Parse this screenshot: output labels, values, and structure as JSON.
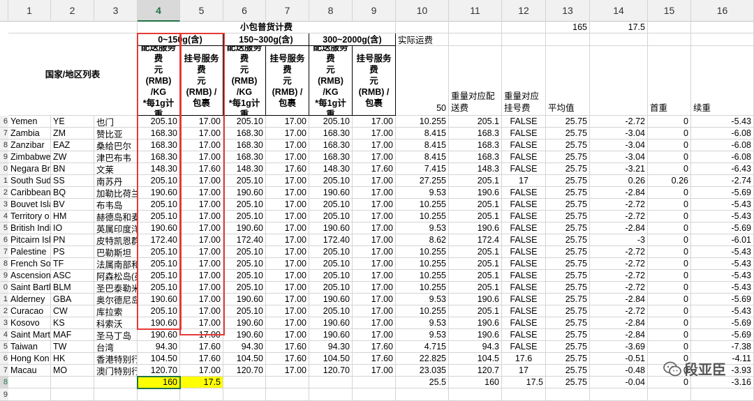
{
  "col_headers": [
    "1",
    "2",
    "3",
    "4",
    "5",
    "6",
    "7",
    "8",
    "9",
    "10",
    "11",
    "12",
    "13",
    "14",
    "15",
    "16"
  ],
  "selected_col": "4",
  "top_values": {
    "m": "165",
    "n": "17.5"
  },
  "merged_header": "小包普货计费",
  "range_headers": [
    "0~150g(含)",
    "150~300g(含)",
    "300~2000g(含)"
  ],
  "actual_freight_label": "实际运费",
  "country_list_label": "国家/地区列表",
  "delivery_header": "配送服务费\n元\n(RMB)\n/KG\n*每1g计重",
  "register_header": "挂号服务费\n元\n(RMB) /\n包裹",
  "subheader_j": "50",
  "subheader_k": "重量对应配送费",
  "subheader_l": "重量对应挂号费",
  "subheader_m": "平均值",
  "subheader_o": "首重",
  "subheader_p": "续重",
  "rows": [
    {
      "n": "6",
      "en": "Yemen",
      "code": "YE",
      "cn": "也门",
      "d1": "205.10",
      "r1": "17.00",
      "d2": "205.10",
      "r2": "17.00",
      "d3": "205.10",
      "r3": "17.00",
      "j": "10.255",
      "k": "205.1",
      "l": "FALSE",
      "m": "25.75",
      "n2": "-2.72",
      "o": "0",
      "p": "-5.43"
    },
    {
      "n": "7",
      "en": "Zambia",
      "code": "ZM",
      "cn": "赞比亚",
      "d1": "168.30",
      "r1": "17.00",
      "d2": "168.30",
      "r2": "17.00",
      "d3": "168.30",
      "r3": "17.00",
      "j": "8.415",
      "k": "168.3",
      "l": "FALSE",
      "m": "25.75",
      "n2": "-3.04",
      "o": "0",
      "p": "-6.08"
    },
    {
      "n": "8",
      "en": "Zanzibar",
      "code": "EAZ",
      "cn": "桑给巴尔",
      "d1": "168.30",
      "r1": "17.00",
      "d2": "168.30",
      "r2": "17.00",
      "d3": "168.30",
      "r3": "17.00",
      "j": "8.415",
      "k": "168.3",
      "l": "FALSE",
      "m": "25.75",
      "n2": "-3.04",
      "o": "0",
      "p": "-6.08"
    },
    {
      "n": "9",
      "en": "Zimbabwe",
      "code": "ZW",
      "cn": "津巴布韦",
      "d1": "168.30",
      "r1": "17.00",
      "d2": "168.30",
      "r2": "17.00",
      "d3": "168.30",
      "r3": "17.00",
      "j": "8.415",
      "k": "168.3",
      "l": "FALSE",
      "m": "25.75",
      "n2": "-3.04",
      "o": "0",
      "p": "-6.08"
    },
    {
      "n": "0",
      "en": "Negara Bru",
      "code": "BN",
      "cn": "文莱",
      "d1": "148.30",
      "r1": "17.60",
      "d2": "148.30",
      "r2": "17.60",
      "d3": "148.30",
      "r3": "17.60",
      "j": "7.415",
      "k": "148.3",
      "l": "FALSE",
      "m": "25.75",
      "n2": "-3.21",
      "o": "0",
      "p": "-6.43"
    },
    {
      "n": "1",
      "en": "South Sud",
      "code": "SS",
      "cn": "南苏丹",
      "d1": "205.10",
      "r1": "17.00",
      "d2": "205.10",
      "r2": "17.00",
      "d3": "205.10",
      "r3": "17.00",
      "j": "27.255",
      "k": "205.1",
      "l": "17",
      "m": "25.75",
      "n2": "0.26",
      "o": "0.26",
      "p": "-2.74"
    },
    {
      "n": "2",
      "en": "Caribbean",
      "code": "BQ",
      "cn": "加勒比荷兰",
      "d1": "190.60",
      "r1": "17.00",
      "d2": "190.60",
      "r2": "17.00",
      "d3": "190.60",
      "r3": "17.00",
      "j": "9.53",
      "k": "190.6",
      "l": "FALSE",
      "m": "25.75",
      "n2": "-2.84",
      "o": "0",
      "p": "-5.69"
    },
    {
      "n": "3",
      "en": "Bouvet Isla",
      "code": "BV",
      "cn": "布韦岛",
      "d1": "205.10",
      "r1": "17.00",
      "d2": "205.10",
      "r2": "17.00",
      "d3": "205.10",
      "r3": "17.00",
      "j": "10.255",
      "k": "205.1",
      "l": "FALSE",
      "m": "25.75",
      "n2": "-2.72",
      "o": "0",
      "p": "-5.43"
    },
    {
      "n": "4",
      "en": "Territory o",
      "code": "HM",
      "cn": "赫德岛和麦",
      "d1": "205.10",
      "r1": "17.00",
      "d2": "205.10",
      "r2": "17.00",
      "d3": "205.10",
      "r3": "17.00",
      "j": "10.255",
      "k": "205.1",
      "l": "FALSE",
      "m": "25.75",
      "n2": "-2.72",
      "o": "0",
      "p": "-5.43"
    },
    {
      "n": "5",
      "en": "British Indi",
      "code": "IO",
      "cn": "英属印度洋",
      "d1": "190.60",
      "r1": "17.00",
      "d2": "190.60",
      "r2": "17.00",
      "d3": "190.60",
      "r3": "17.00",
      "j": "9.53",
      "k": "190.6",
      "l": "FALSE",
      "m": "25.75",
      "n2": "-2.84",
      "o": "0",
      "p": "-5.69"
    },
    {
      "n": "6",
      "en": "Pitcairn Isl",
      "code": "PN",
      "cn": "皮特凯恩群",
      "d1": "172.40",
      "r1": "17.00",
      "d2": "172.40",
      "r2": "17.00",
      "d3": "172.40",
      "r3": "17.00",
      "j": "8.62",
      "k": "172.4",
      "l": "FALSE",
      "m": "25.75",
      "n2": "-3",
      "o": "0",
      "p": "-6.01"
    },
    {
      "n": "7",
      "en": "Palestine",
      "code": "PS",
      "cn": "巴勒斯坦",
      "d1": "205.10",
      "r1": "17.00",
      "d2": "205.10",
      "r2": "17.00",
      "d3": "205.10",
      "r3": "17.00",
      "j": "10.255",
      "k": "205.1",
      "l": "FALSE",
      "m": "25.75",
      "n2": "-2.72",
      "o": "0",
      "p": "-5.43"
    },
    {
      "n": "8",
      "en": "French Sou",
      "code": "TF",
      "cn": "法属南部和",
      "d1": "205.10",
      "r1": "17.00",
      "d2": "205.10",
      "r2": "17.00",
      "d3": "205.10",
      "r3": "17.00",
      "j": "10.255",
      "k": "205.1",
      "l": "FALSE",
      "m": "25.75",
      "n2": "-2.72",
      "o": "0",
      "p": "-5.43"
    },
    {
      "n": "9",
      "en": "Ascension",
      "code": "ASC",
      "cn": "阿森松岛(英",
      "d1": "205.10",
      "r1": "17.00",
      "d2": "205.10",
      "r2": "17.00",
      "d3": "205.10",
      "r3": "17.00",
      "j": "10.255",
      "k": "205.1",
      "l": "FALSE",
      "m": "25.75",
      "n2": "-2.72",
      "o": "0",
      "p": "-5.43"
    },
    {
      "n": "0",
      "en": "Saint Barth",
      "code": "BLM",
      "cn": "圣巴泰勒米",
      "d1": "205.10",
      "r1": "17.00",
      "d2": "205.10",
      "r2": "17.00",
      "d3": "205.10",
      "r3": "17.00",
      "j": "10.255",
      "k": "205.1",
      "l": "FALSE",
      "m": "25.75",
      "n2": "-2.72",
      "o": "0",
      "p": "-5.43"
    },
    {
      "n": "1",
      "en": "Alderney",
      "code": "GBA",
      "cn": "奥尔德尼岛",
      "d1": "190.60",
      "r1": "17.00",
      "d2": "190.60",
      "r2": "17.00",
      "d3": "190.60",
      "r3": "17.00",
      "j": "9.53",
      "k": "190.6",
      "l": "FALSE",
      "m": "25.75",
      "n2": "-2.84",
      "o": "0",
      "p": "-5.69"
    },
    {
      "n": "2",
      "en": "Curacao",
      "code": "CW",
      "cn": "库拉索",
      "d1": "205.10",
      "r1": "17.00",
      "d2": "205.10",
      "r2": "17.00",
      "d3": "205.10",
      "r3": "17.00",
      "j": "10.255",
      "k": "205.1",
      "l": "FALSE",
      "m": "25.75",
      "n2": "-2.72",
      "o": "0",
      "p": "-5.43"
    },
    {
      "n": "3",
      "en": "Kosovo",
      "code": "KS",
      "cn": "科索沃",
      "d1": "190.60",
      "r1": "17.00",
      "d2": "190.60",
      "r2": "17.00",
      "d3": "190.60",
      "r3": "17.00",
      "j": "9.53",
      "k": "190.6",
      "l": "FALSE",
      "m": "25.75",
      "n2": "-2.84",
      "o": "0",
      "p": "-5.69"
    },
    {
      "n": "4",
      "en": "Saint Mart",
      "code": "MAF",
      "cn": "圣马丁岛",
      "d1": "190.60",
      "r1": "17.00",
      "d2": "190.60",
      "r2": "17.00",
      "d3": "190.60",
      "r3": "17.00",
      "j": "9.53",
      "k": "190.6",
      "l": "FALSE",
      "m": "25.75",
      "n2": "-2.84",
      "o": "0",
      "p": "-5.69"
    },
    {
      "n": "5",
      "en": "Taiwan",
      "code": "TW",
      "cn": "台湾",
      "d1": "94.30",
      "r1": "17.60",
      "d2": "94.30",
      "r2": "17.60",
      "d3": "94.30",
      "r3": "17.60",
      "j": "4.715",
      "k": "94.3",
      "l": "FALSE",
      "m": "25.75",
      "n2": "-3.69",
      "o": "0",
      "p": "-7.38"
    },
    {
      "n": "6",
      "en": "Hong Kon",
      "code": "HK",
      "cn": "香港特别行",
      "d1": "104.50",
      "r1": "17.60",
      "d2": "104.50",
      "r2": "17.60",
      "d3": "104.50",
      "r3": "17.60",
      "j": "22.825",
      "k": "104.5",
      "l": "17.6",
      "m": "25.75",
      "n2": "-0.51",
      "o": "0",
      "p": "-4.11"
    },
    {
      "n": "7",
      "en": "Macau",
      "code": "MO",
      "cn": "澳门特别行",
      "d1": "120.70",
      "r1": "17.00",
      "d2": "120.70",
      "r2": "17.00",
      "d3": "120.70",
      "r3": "17.00",
      "j": "23.035",
      "k": "120.7",
      "l": "17",
      "m": "25.75",
      "n2": "-0.48",
      "o": "0",
      "p": "-3.93"
    }
  ],
  "total_row": {
    "n": "8",
    "d1": "160",
    "r1": "17.5",
    "j": "25.5",
    "k": "160",
    "l": "17.5",
    "m": "25.75",
    "n2": "-0.04",
    "o": "0",
    "p": "-3.16"
  },
  "last_row_num": "9",
  "watermark_text": "段亚臣",
  "colors": {
    "yellow": "#ffff00",
    "red_box": "#e53935",
    "selection": "#217346"
  }
}
